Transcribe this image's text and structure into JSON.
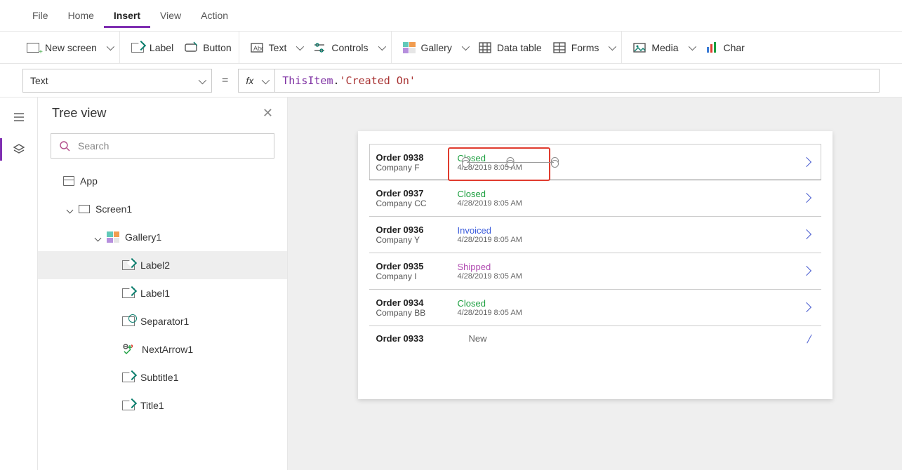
{
  "menu": {
    "items": [
      "File",
      "Home",
      "Insert",
      "View",
      "Action"
    ],
    "active": "Insert"
  },
  "ribbon": {
    "new_screen": "New screen",
    "label": "Label",
    "button": "Button",
    "text": "Text",
    "controls": "Controls",
    "gallery": "Gallery",
    "data_table": "Data table",
    "forms": "Forms",
    "media": "Media",
    "charts": "Char"
  },
  "formula": {
    "property": "Text",
    "fx": "fx",
    "tok_this": "ThisItem",
    "dot": ".",
    "tok_str": "'Created On'"
  },
  "treeview": {
    "title": "Tree view",
    "search_placeholder": "Search",
    "items": [
      {
        "level": 1,
        "label": "App",
        "icon": "app"
      },
      {
        "level": 2,
        "label": "Screen1",
        "icon": "screen",
        "expanded": true
      },
      {
        "level": 3,
        "label": "Gallery1",
        "icon": "gallery",
        "expanded": true
      },
      {
        "level": 4,
        "label": "Label2",
        "icon": "label",
        "selected": true
      },
      {
        "level": 4,
        "label": "Label1",
        "icon": "label"
      },
      {
        "level": 4,
        "label": "Separator1",
        "icon": "sep"
      },
      {
        "level": 4,
        "label": "NextArrow1",
        "icon": "next"
      },
      {
        "level": 4,
        "label": "Subtitle1",
        "icon": "label"
      },
      {
        "level": 4,
        "label": "Title1",
        "icon": "label"
      }
    ]
  },
  "gallery": [
    {
      "order": "Order 0938",
      "company": "Company F",
      "status": "Closed",
      "status_class": "closed",
      "date": "4/28/2019 8:05 AM",
      "selected": true
    },
    {
      "order": "Order 0937",
      "company": "Company CC",
      "status": "Closed",
      "status_class": "closed",
      "date": "4/28/2019 8:05 AM"
    },
    {
      "order": "Order 0936",
      "company": "Company Y",
      "status": "Invoiced",
      "status_class": "invoiced",
      "date": "4/28/2019 8:05 AM"
    },
    {
      "order": "Order 0935",
      "company": "Company I",
      "status": "Shipped",
      "status_class": "shipped",
      "date": "4/28/2019 8:05 AM"
    },
    {
      "order": "Order 0934",
      "company": "Company BB",
      "status": "Closed",
      "status_class": "closed",
      "date": "4/28/2019 8:05 AM"
    },
    {
      "order": "Order 0933",
      "company": "",
      "status": "New",
      "status_class": "new",
      "date": "",
      "partial": true
    }
  ]
}
